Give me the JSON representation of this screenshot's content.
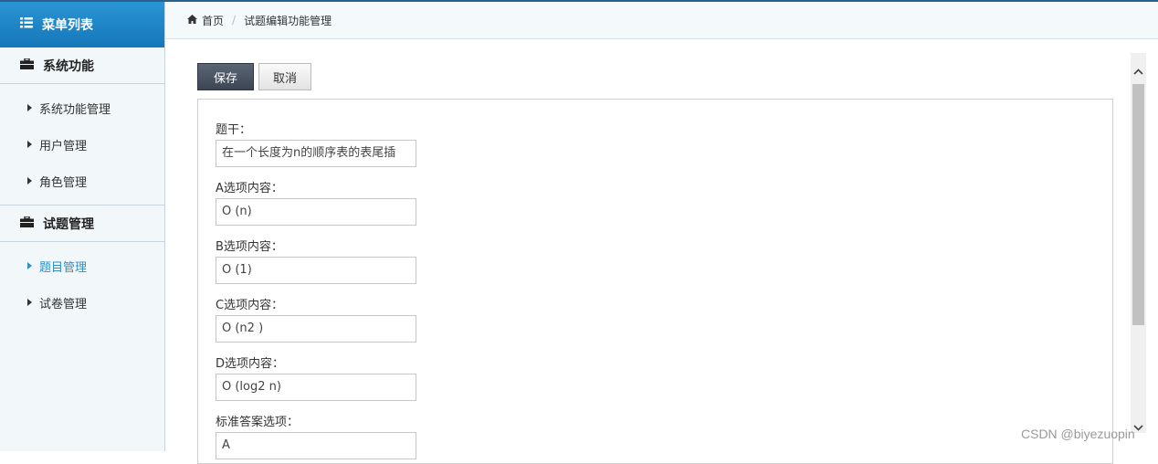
{
  "sidebar": {
    "header": "菜单列表",
    "groups": [
      {
        "label": "系统功能",
        "items": [
          "系统功能管理",
          "用户管理",
          "角色管理"
        ]
      },
      {
        "label": "试题管理",
        "items": [
          "题目管理",
          "试卷管理"
        ]
      }
    ],
    "active_item": "题目管理"
  },
  "breadcrumb": {
    "home": "首页",
    "current": "试题编辑功能管理"
  },
  "toolbar": {
    "save_label": "保存",
    "cancel_label": "取消"
  },
  "form": {
    "stem_label": "题干：",
    "stem_value": "在一个长度为n的顺序表的表尾插",
    "a_label": "A选项内容：",
    "a_value": "O (n)",
    "b_label": "B选项内容：",
    "b_value": "O (1)",
    "c_label": "C选项内容：",
    "c_value": "O (n2 )",
    "d_label": "D选项内容：",
    "d_value": "O (log2 n)",
    "answer_label": "标准答案选项：",
    "answer_value": "A"
  },
  "watermark": "CSDN @biyezuopin",
  "colors": {
    "accent": "#1e85c7",
    "active_item": "#2f8fc7",
    "save_button": "#4a5462"
  }
}
